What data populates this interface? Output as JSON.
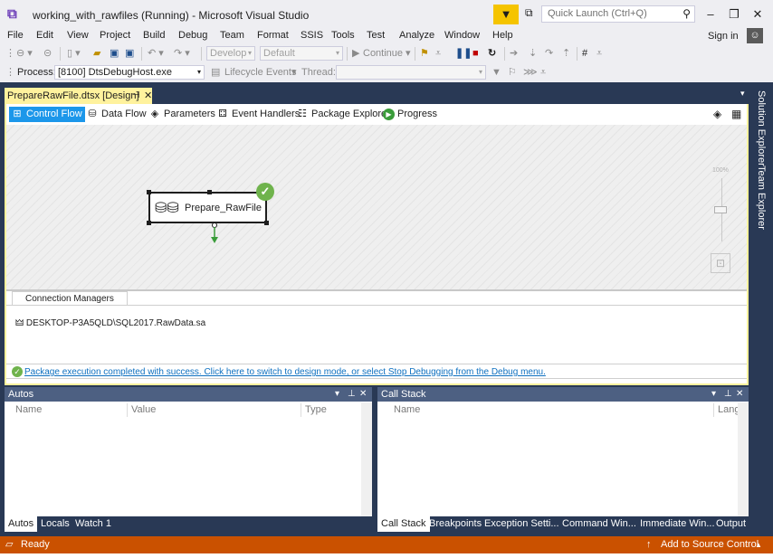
{
  "window": {
    "title": "working_with_rawfiles (Running) - Microsoft Visual Studio",
    "quick_launch_placeholder": "Quick Launch (Ctrl+Q)",
    "sign_in": "Sign in"
  },
  "menu": [
    "File",
    "Edit",
    "View",
    "Project",
    "Build",
    "Debug",
    "Team",
    "Format",
    "SSIS",
    "Tools",
    "Test",
    "Analyze",
    "Window",
    "Help"
  ],
  "toolbar": {
    "config_combo": "Develop",
    "platform_combo": "Default",
    "continue_label": "Continue",
    "process_label": "Process:",
    "process_value": "[8100] DtsDebugHost.exe",
    "lifecycle_label": "Lifecycle Events",
    "thread_label": "Thread:"
  },
  "document_tab": {
    "title": "PrepareRawFile.dtsx [Design]"
  },
  "side_tabs": [
    "Solution Explorer",
    "Team Explorer"
  ],
  "designer_tabs": [
    {
      "label": "Control Flow",
      "icon": "control-flow-icon",
      "active": true
    },
    {
      "label": "Data Flow",
      "icon": "data-flow-icon",
      "active": false
    },
    {
      "label": "Parameters",
      "icon": "parameters-icon",
      "active": false
    },
    {
      "label": "Event Handlers",
      "icon": "event-handlers-icon",
      "active": false
    },
    {
      "label": "Package Explorer",
      "icon": "package-explorer-icon",
      "active": false
    },
    {
      "label": "Progress",
      "icon": "progress-icon",
      "active": false
    }
  ],
  "canvas": {
    "task_label": "Prepare_RawFile",
    "zoom_label": "100%"
  },
  "connection_managers": {
    "tab_label": "Connection Managers",
    "items": [
      "DESKTOP-P3A5QLD\\SQL2017.RawData.sa"
    ]
  },
  "info_bar": {
    "message": "Package execution completed with success. Click here to switch to design mode, or select Stop Debugging from the Debug menu."
  },
  "autos": {
    "title": "Autos",
    "columns": [
      "Name",
      "Value",
      "Type"
    ],
    "tabs": [
      "Autos",
      "Locals",
      "Watch 1"
    ]
  },
  "call_stack": {
    "title": "Call Stack",
    "columns": [
      "Name",
      "Lang"
    ],
    "tabs": [
      "Call Stack",
      "Breakpoints",
      "Exception Setti...",
      "Command Win...",
      "Immediate Win...",
      "Output"
    ]
  },
  "status": {
    "text": "Ready",
    "source_control": "Add to Source Control"
  },
  "colors": {
    "accent": "#1c97ea",
    "status_bar": "#ca5100",
    "frame": "#293955",
    "doc_tab": "#fff29d",
    "success": "#6fb34c"
  }
}
